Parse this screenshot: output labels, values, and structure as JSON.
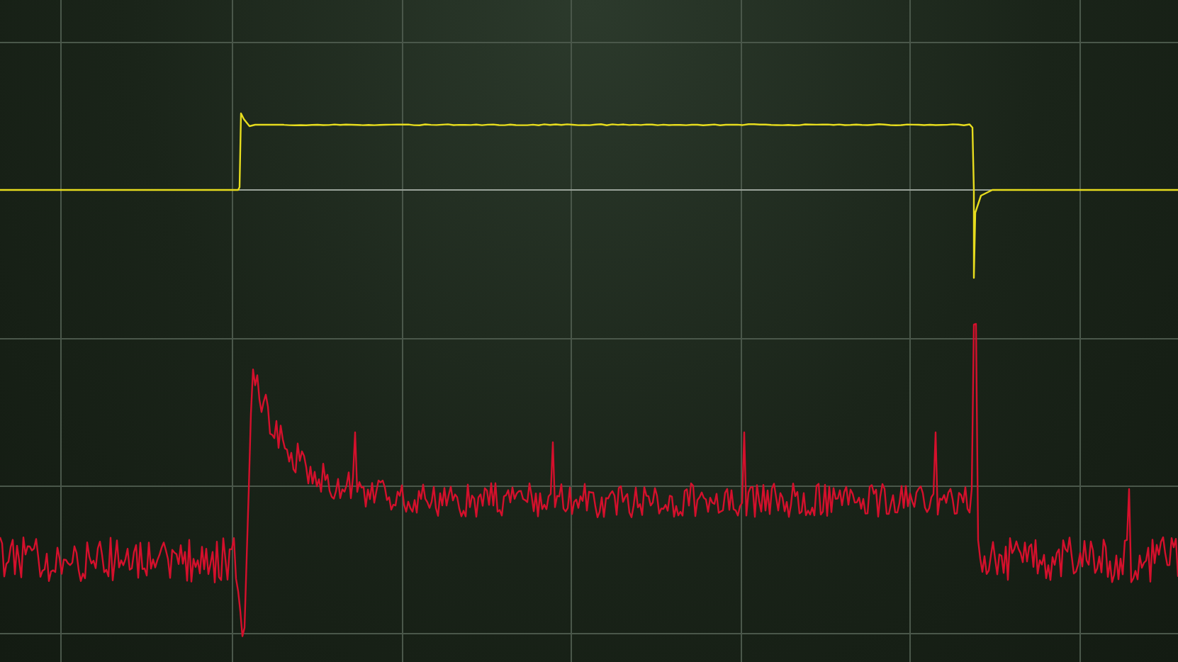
{
  "scope": {
    "traces": [
      {
        "kind": "step",
        "color": "#e6dc1e"
      },
      {
        "kind": "noise",
        "color": "#d4102c"
      }
    ]
  }
}
